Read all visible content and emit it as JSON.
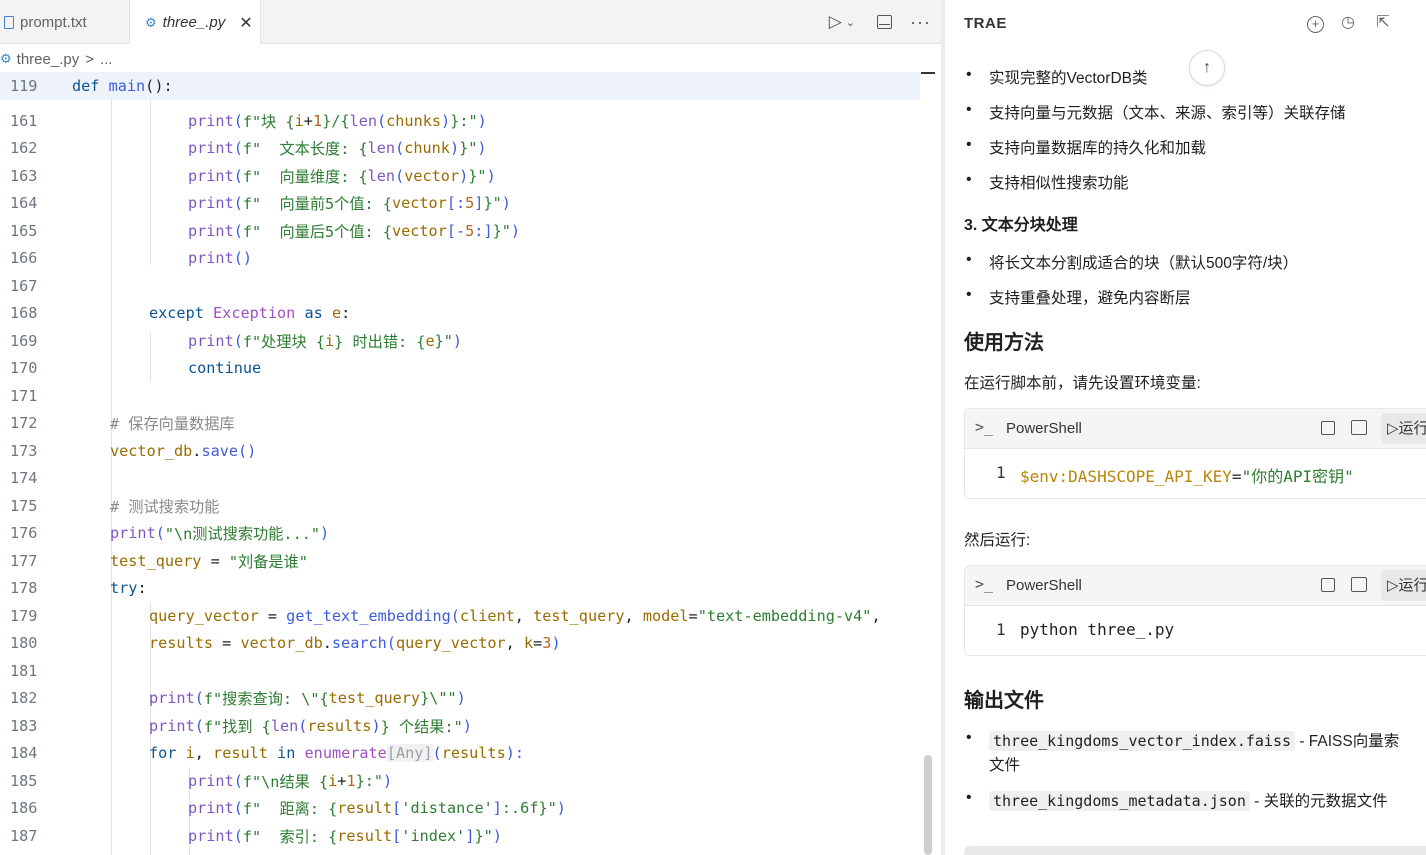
{
  "editor": {
    "tabs": [
      {
        "label": "prompt.txt"
      },
      {
        "label": "three_.py"
      }
    ],
    "breadcrumb": {
      "file": "three_.py",
      "sep": ">",
      "rest": "..."
    },
    "lines": [
      {
        "num": "119"
      },
      {
        "num": "161"
      },
      {
        "num": "162"
      },
      {
        "num": "163"
      },
      {
        "num": "164"
      },
      {
        "num": "165"
      },
      {
        "num": "166"
      },
      {
        "num": "167"
      },
      {
        "num": "168"
      },
      {
        "num": "169"
      },
      {
        "num": "170"
      },
      {
        "num": "171"
      },
      {
        "num": "172"
      },
      {
        "num": "173"
      },
      {
        "num": "174"
      },
      {
        "num": "175"
      },
      {
        "num": "176"
      },
      {
        "num": "177"
      },
      {
        "num": "178"
      },
      {
        "num": "179"
      },
      {
        "num": "180"
      },
      {
        "num": "181"
      },
      {
        "num": "182"
      },
      {
        "num": "183"
      },
      {
        "num": "184"
      },
      {
        "num": "185"
      },
      {
        "num": "186"
      },
      {
        "num": "187"
      }
    ],
    "code": {
      "l119": [
        "def",
        " ",
        "main",
        "():"
      ],
      "l161": [
        "print",
        "(",
        "f\"块 {",
        "i",
        "+",
        "1",
        "}/{",
        "len",
        "(",
        "chunks",
        ")",
        "}:\"",
        ")"
      ],
      "l162": [
        "print",
        "(",
        "f\"  文本长度: {",
        "len",
        "(",
        "chunk",
        ")",
        "}\"",
        ")"
      ],
      "l163": [
        "print",
        "(",
        "f\"  向量维度: {",
        "len",
        "(",
        "vector",
        ")",
        "}\"",
        ")"
      ],
      "l164": [
        "print",
        "(",
        "f\"  向量前5个值: {",
        "vector",
        "[:",
        "5",
        "]",
        "}\"",
        ")"
      ],
      "l165": [
        "print",
        "(",
        "f\"  向量后5个值: {",
        "vector",
        "[-",
        "5",
        ":]",
        "}\"",
        ")"
      ],
      "l166": [
        "print",
        "()"
      ],
      "l168": [
        "except",
        " ",
        "Exception",
        " ",
        "as",
        " ",
        "e",
        ":"
      ],
      "l169": [
        "print",
        "(",
        "f\"处理块 {",
        "i",
        "} 时出错: {",
        "e",
        "}\"",
        ")"
      ],
      "l170": [
        "continue"
      ],
      "l172": [
        "# 保存向量数据库"
      ],
      "l173": [
        "vector_db",
        ".",
        "save",
        "()"
      ],
      "l175": [
        "# 测试搜索功能"
      ],
      "l176": [
        "print",
        "(",
        "\"\\n测试搜索功能...\"",
        ")"
      ],
      "l177": [
        "test_query",
        " = ",
        "\"刘备是谁\""
      ],
      "l178": [
        "try",
        ":"
      ],
      "l179": [
        "query_vector",
        " = ",
        "get_text_embedding",
        "(",
        "client",
        ", ",
        "test_query",
        ", ",
        "model",
        "=",
        "\"text-embedding-v4\"",
        ","
      ],
      "l180": [
        "results",
        " = ",
        "vector_db",
        ".",
        "search",
        "(",
        "query_vector",
        ", ",
        "k",
        "=",
        "3",
        ")"
      ],
      "l182": [
        "print",
        "(",
        "f\"搜索查询: \\\"{",
        "test_query",
        "}\\\"\"",
        ")"
      ],
      "l183": [
        "print",
        "(",
        "f\"找到 {",
        "len",
        "(",
        "results",
        ")",
        "} 个结果:\"",
        ")"
      ],
      "l184": [
        "for",
        " ",
        "i",
        ", ",
        "result",
        " ",
        "in",
        " ",
        "enumerate",
        "[Any]",
        "(",
        "results",
        "):"
      ],
      "l185": [
        "print",
        "(",
        "f\"\\n结果 {",
        "i",
        "+",
        "1",
        "}:\"",
        ")"
      ],
      "l186": [
        "print",
        "(",
        "f\"  距离: {",
        "result",
        "[",
        "'distance'",
        "]",
        ":.6f",
        "}\"",
        ")"
      ],
      "l187": [
        "print",
        "(",
        "f\"  索引: {",
        "result",
        "[",
        "'index'",
        "]",
        "}\"",
        ")"
      ]
    }
  },
  "chat": {
    "title": "TRAE",
    "bullets_a": [
      "实现完整的VectorDB类",
      "支持向量与元数据（文本、来源、索引等）关联存储",
      "支持向量数据库的持久化和加载",
      "支持相似性搜索功能"
    ],
    "section3_title": "3. 文本分块处理",
    "bullets_b": [
      "将长文本分割成适合的块（默认500字符/块）",
      "支持重叠处理，避免内容断层"
    ],
    "usage_title": "使用方法",
    "usage_intro": "在运行脚本前，请先设置环境变量:",
    "block1": {
      "lang": "PowerShell",
      "run": "▷运行",
      "line_no": "1",
      "var": "$env:DASHSCOPE_API_KEY",
      "op": "=",
      "str": "\"你的API密钥\""
    },
    "then_run": "然后运行:",
    "block2": {
      "lang": "PowerShell",
      "run": "▷运行",
      "line_no": "1",
      "code": "python three_.py"
    },
    "output_title": "输出文件",
    "outputs": [
      {
        "code": "three_kingdoms_vector_index.faiss",
        "desc": " - FAISS向量索",
        "desc2": "文件"
      },
      {
        "code": "three_kingdoms_metadata.json",
        "desc": " - 关联的元数据文件"
      }
    ]
  }
}
